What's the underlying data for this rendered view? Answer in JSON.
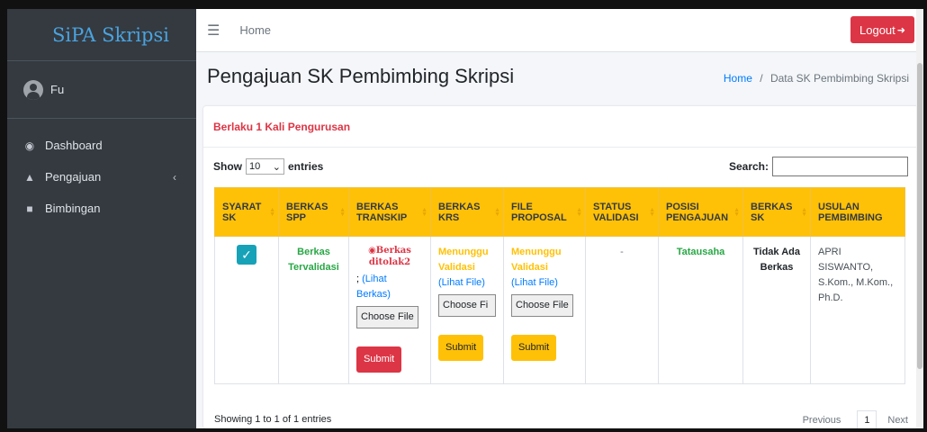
{
  "brand": "SiPA Skripsi",
  "user": {
    "name": "Fu"
  },
  "sidebar": {
    "items": [
      {
        "label": "Dashboard",
        "icon": "dashboard-icon"
      },
      {
        "label": "Pengajuan",
        "icon": "graduation-cap-icon"
      },
      {
        "label": "Bimbingan",
        "icon": "book-icon"
      }
    ]
  },
  "topbar": {
    "home": "Home",
    "logout": "Logout"
  },
  "page": {
    "title": "Pengajuan SK Pembimbing Skripsi",
    "breadcrumb_home": "Home",
    "breadcrumb_sep": "/",
    "breadcrumb_current": "Data SK Pembimbing Skripsi"
  },
  "card": {
    "header": "Berlaku 1 Kali Pengurusan",
    "show_label": "Show",
    "entries_value": "10",
    "entries_label": "entries",
    "search_label": "Search:"
  },
  "table": {
    "headers": [
      [
        "SYARAT",
        "SK"
      ],
      [
        "BERKAS",
        "SPP"
      ],
      [
        "BERKAS",
        "TRANSKIP"
      ],
      [
        "BERKAS",
        "KRS"
      ],
      [
        "FILE",
        "PROPOSAL"
      ],
      [
        "STATUS",
        "VALIDASI"
      ],
      [
        "POSISI",
        "PENGAJUAN"
      ],
      [
        "BERKAS",
        "SK"
      ],
      [
        "USULAN",
        "PEMBIMBING"
      ]
    ],
    "row": {
      "spp": "Berkas Tervalidasi",
      "transkip_status": "Berkas ditolak2",
      "transkip_sep": ";",
      "transkip_link": "(Lihat Berkas)",
      "krs_status": "Menunggu Validasi",
      "krs_link": "(Lihat File)",
      "proposal_status": "Menunggu Validasi",
      "proposal_link": "(Lihat File)",
      "choose_file": "Choose File",
      "choose_file_truncated": "Choose Fi",
      "submit": "Submit",
      "status_validasi": "-",
      "posisi": "Tatausaha",
      "berkas_sk": "Tidak Ada Berkas",
      "pembimbing": "APRI SISWANTO, S.Kom., M.Kom., Ph.D."
    }
  },
  "footer": {
    "info": "Showing 1 to 1 of 1 entries",
    "previous": "Previous",
    "page": "1",
    "next": "Next"
  },
  "colors": {
    "sidebar": "#343a40",
    "brand": "#4aa3df",
    "header": "#ffc107",
    "danger": "#dc3545",
    "success": "#28a745",
    "info": "#17a2b8",
    "link": "#007bff"
  }
}
